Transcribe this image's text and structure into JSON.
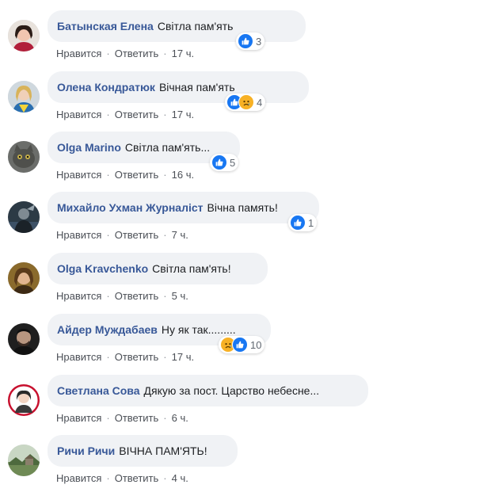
{
  "action_like": "Нравится",
  "action_reply": "Ответить",
  "separator": "·",
  "comments": [
    {
      "author": "Батынская Елена",
      "text": "Світла пам'ять",
      "time": "17 ч.",
      "reactions": [
        "like"
      ],
      "reaction_count": "3",
      "avatar": "avatar-woman-dark-hair"
    },
    {
      "author": "Олена Кондратюк",
      "text": "Вічная пам'ять",
      "time": "17 ч.",
      "reactions": [
        "like",
        "sad"
      ],
      "reaction_count": "4",
      "avatar": "avatar-woman-blonde"
    },
    {
      "author": "Olga Marino",
      "text": "Світла пам'ять...",
      "time": "16 ч.",
      "reactions": [
        "like"
      ],
      "reaction_count": "5",
      "avatar": "avatar-cat"
    },
    {
      "author": "Михайло Ухман Журналіст",
      "text": "Вічна память!",
      "time": "7 ч.",
      "reactions": [
        "like"
      ],
      "reaction_count": "1",
      "avatar": "avatar-dark-figure"
    },
    {
      "author": "Olga Kravchenko",
      "text": "Світла пам'ять!",
      "time": "5 ч.",
      "reactions": [],
      "reaction_count": "",
      "avatar": "avatar-woman-warm"
    },
    {
      "author": "Айдер Муждабаев",
      "text": "Ну як так.........",
      "time": "17 ч.",
      "reactions": [
        "sad",
        "like"
      ],
      "reaction_count": "10",
      "avatar": "avatar-man-dark"
    },
    {
      "author": "Светлана Сова",
      "text": "Дякую за пост. Царство небесне...",
      "time": "6 ч.",
      "reactions": [],
      "reaction_count": "",
      "avatar": "avatar-woman-red-frame"
    },
    {
      "author": "Ричи Ричи",
      "text": "ВІЧНА ПАМ'ЯТЬ!",
      "time": "4 ч.",
      "reactions": [],
      "reaction_count": "",
      "avatar": "avatar-landscape"
    }
  ],
  "colors": {
    "author": "#385898",
    "bubble": "#f0f2f5",
    "like": "#1877f2",
    "sad": "#f7b125",
    "meta": "#606770"
  }
}
